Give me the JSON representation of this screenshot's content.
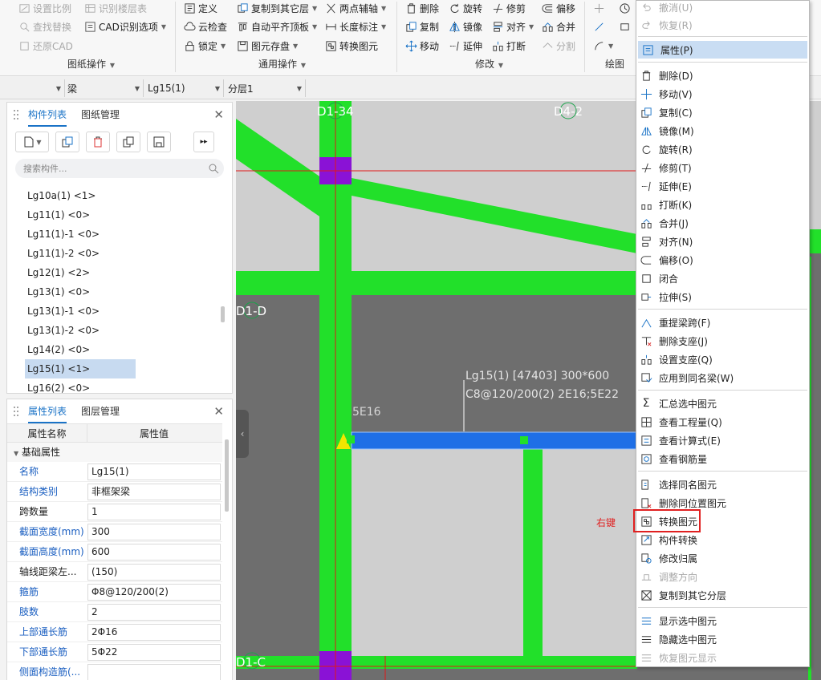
{
  "ribbon": {
    "drawing_ops": {
      "items": [
        "设置比例",
        "识别楼层表",
        "查找替换",
        "CAD识别选项",
        "还原CAD"
      ],
      "group_label": "图纸操作"
    },
    "general_ops": {
      "items": [
        "定义",
        "复制到其它层",
        "两点辅轴",
        "云检查",
        "自动平齐顶板",
        "长度标注",
        "锁定",
        "图元存盘",
        "转换图元"
      ],
      "group_label": "通用操作"
    },
    "modify": {
      "items": [
        "删除",
        "旋转",
        "修剪",
        "偏移",
        "复制",
        "镜像",
        "对齐",
        "合并",
        "移动",
        "延伸",
        "打断",
        "分割"
      ],
      "group_label": "修改"
    },
    "draw": {
      "group_label": "绘图"
    }
  },
  "filterbar": {
    "element_type": "梁",
    "element_name": "Lg15(1)",
    "layer": "分层1"
  },
  "component_panel": {
    "tabs": [
      "构件列表",
      "图纸管理"
    ],
    "search_placeholder": "搜索构件...",
    "items": [
      "Lg10a(1) <1>",
      "Lg11(1) <0>",
      "Lg11(1)-1 <0>",
      "Lg11(1)-2 <0>",
      "Lg12(1) <2>",
      "Lg13(1) <0>",
      "Lg13(1)-1 <0>",
      "Lg13(1)-2 <0>",
      "Lg14(2) <0>",
      "Lg15(1) <1>",
      "Lg16(2) <0>"
    ],
    "selected_index": 9
  },
  "property_panel": {
    "tabs": [
      "属性列表",
      "图层管理"
    ],
    "columns": [
      "属性名称",
      "属性值"
    ],
    "group": "基础属性",
    "rows": [
      {
        "name": "名称",
        "value": "Lg15(1)"
      },
      {
        "name": "结构类别",
        "value": "非框架梁"
      },
      {
        "name": "跨数量",
        "value": "1"
      },
      {
        "name": "截面宽度(mm)",
        "value": "300"
      },
      {
        "name": "截面高度(mm)",
        "value": "600"
      },
      {
        "name": "轴线距梁左...",
        "value": "(150)"
      },
      {
        "name": "箍筋",
        "value": "Φ8@120/200(2)"
      },
      {
        "name": "肢数",
        "value": "2"
      },
      {
        "name": "上部通长筋",
        "value": "2Φ16"
      },
      {
        "name": "下部通长筋",
        "value": "5Φ22"
      },
      {
        "name": "侧面构造筋(...",
        "value": ""
      }
    ]
  },
  "canvas": {
    "axis_labels": [
      "D1-34",
      "D4-2",
      "D1-D",
      "D1-C"
    ],
    "beam_annotation_line1": "Lg15(1) [47403] 300*600",
    "beam_annotation_line2": "C8@120/200(2) 2E16;5E22",
    "span_label": "5E16",
    "right_click_note": "右键"
  },
  "context_menu": {
    "items": [
      "撤消(U)",
      "恢复(R)",
      "属性(P)",
      "删除(D)",
      "移动(V)",
      "复制(C)",
      "镜像(M)",
      "旋转(R)",
      "修剪(T)",
      "延伸(E)",
      "打断(K)",
      "合并(J)",
      "对齐(N)",
      "偏移(O)",
      "闭合",
      "拉伸(S)",
      "重提梁跨(F)",
      "删除支座(J)",
      "设置支座(Q)",
      "应用到同名梁(W)",
      "汇总选中图元",
      "查看工程量(Q)",
      "查看计算式(E)",
      "查看钢筋量",
      "选择同名图元",
      "删除同位置图元",
      "转换图元",
      "构件转换",
      "修改归属",
      "调整方向",
      "复制到其它分层",
      "显示选中图元",
      "隐藏选中图元",
      "恢复图元显示"
    ],
    "highlighted": "属性(P)",
    "boxed": "转换图元"
  },
  "colors": {
    "beam_green": "#22e02a",
    "selected_beam_blue": "#1f6fe6",
    "column_purple": "#8a12d6",
    "highlight": "#c9ddf3",
    "accent": "#1a73c7",
    "red_box": "#e02020"
  }
}
